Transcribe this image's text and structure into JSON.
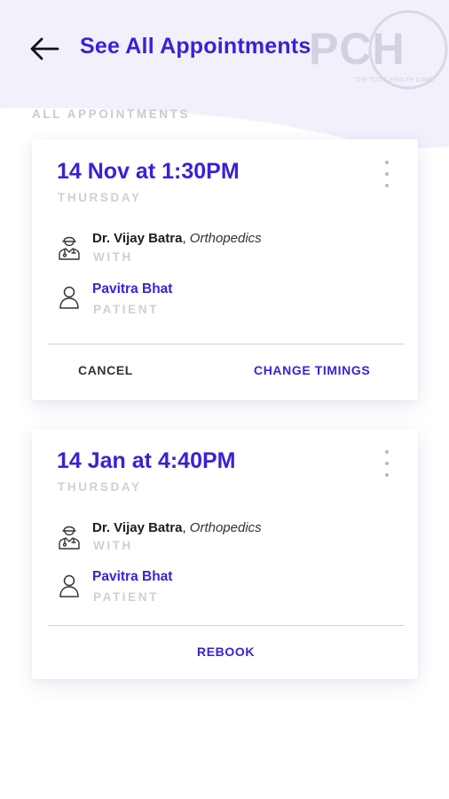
{
  "header": {
    "back_icon": "arrow-left-icon",
    "title": "See All Appointments",
    "logo_text": "PCH",
    "logo_tagline": "THE TOTAL HEALTH CARE"
  },
  "colors": {
    "accent": "#3d1fd6",
    "muted": "#cfcfd6",
    "background_tint": "#f1f0fb"
  },
  "section_label": "ALL APPOINTMENTS",
  "appointments": [
    {
      "time": "14 Nov at 1:30PM",
      "day": "THURSDAY",
      "doctor_name": "Dr. Vijay Batra",
      "separator": ", ",
      "specialty": "Orthopedics",
      "with_label": "WITH",
      "patient_name": "Pavitra Bhat",
      "patient_label": "PATIENT",
      "actions": [
        "CANCEL",
        "CHANGE TIMINGS"
      ]
    },
    {
      "time": "14 Jan at 4:40PM",
      "day": "THURSDAY",
      "doctor_name": "Dr. Vijay Batra",
      "separator": ", ",
      "specialty": "Orthopedics",
      "with_label": "WITH",
      "patient_name": "Pavitra Bhat",
      "patient_label": "PATIENT",
      "actions": [
        "REBOOK"
      ]
    }
  ]
}
